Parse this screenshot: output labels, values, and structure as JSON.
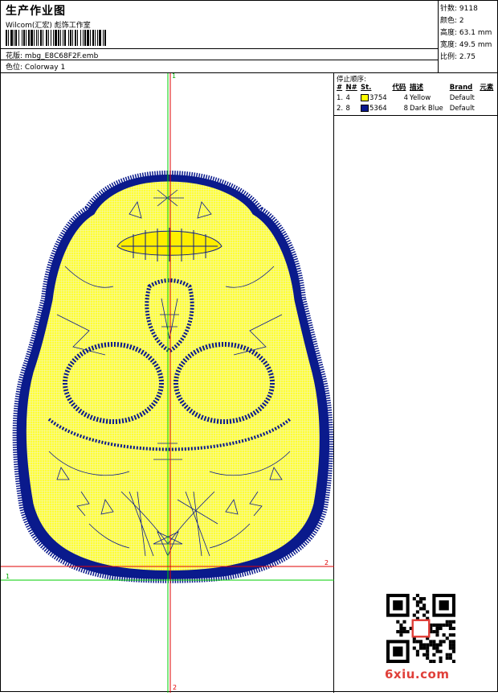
{
  "header": {
    "title": "生产作业图",
    "company": "Wilcom(汇宏) 彪饰工作室",
    "design_label": "花版:",
    "design_value": "mbg_E8C68F2F.emb",
    "colorway_label": "色位:",
    "colorway_value": "Colorway 1"
  },
  "stats": [
    {
      "label": "针数:",
      "value": "9118"
    },
    {
      "label": "颜色:",
      "value": "2"
    },
    {
      "label": "高度:",
      "value": "63.1 mm"
    },
    {
      "label": "宽度:",
      "value": "49.5 mm"
    },
    {
      "label": "比例:",
      "value": "2.75"
    }
  ],
  "stops": {
    "title": "停止顺序:",
    "columns": [
      "#",
      "N#",
      "St.",
      "代码",
      "描述",
      "Brand",
      "元素"
    ],
    "rows": [
      {
        "index": "1.",
        "needle": "4",
        "color": "#ffff00",
        "stitches": "3754",
        "code": "4",
        "desc": "Yellow",
        "brand": "Default"
      },
      {
        "index": "2.",
        "needle": "8",
        "color": "#0a1a8c",
        "stitches": "5364",
        "code": "8",
        "desc": "Dark Blue",
        "brand": "Default"
      }
    ]
  },
  "guides": {
    "v_top": "1",
    "v_bottom": "2",
    "h_left": "1",
    "h_right": "2"
  },
  "colors": {
    "fill": "#ffff33",
    "stitch_blue": "#0a1a8c",
    "guide_green": "#00cc00",
    "guide_red": "#e00000"
  },
  "watermark": {
    "logo": "6xiu.com"
  }
}
